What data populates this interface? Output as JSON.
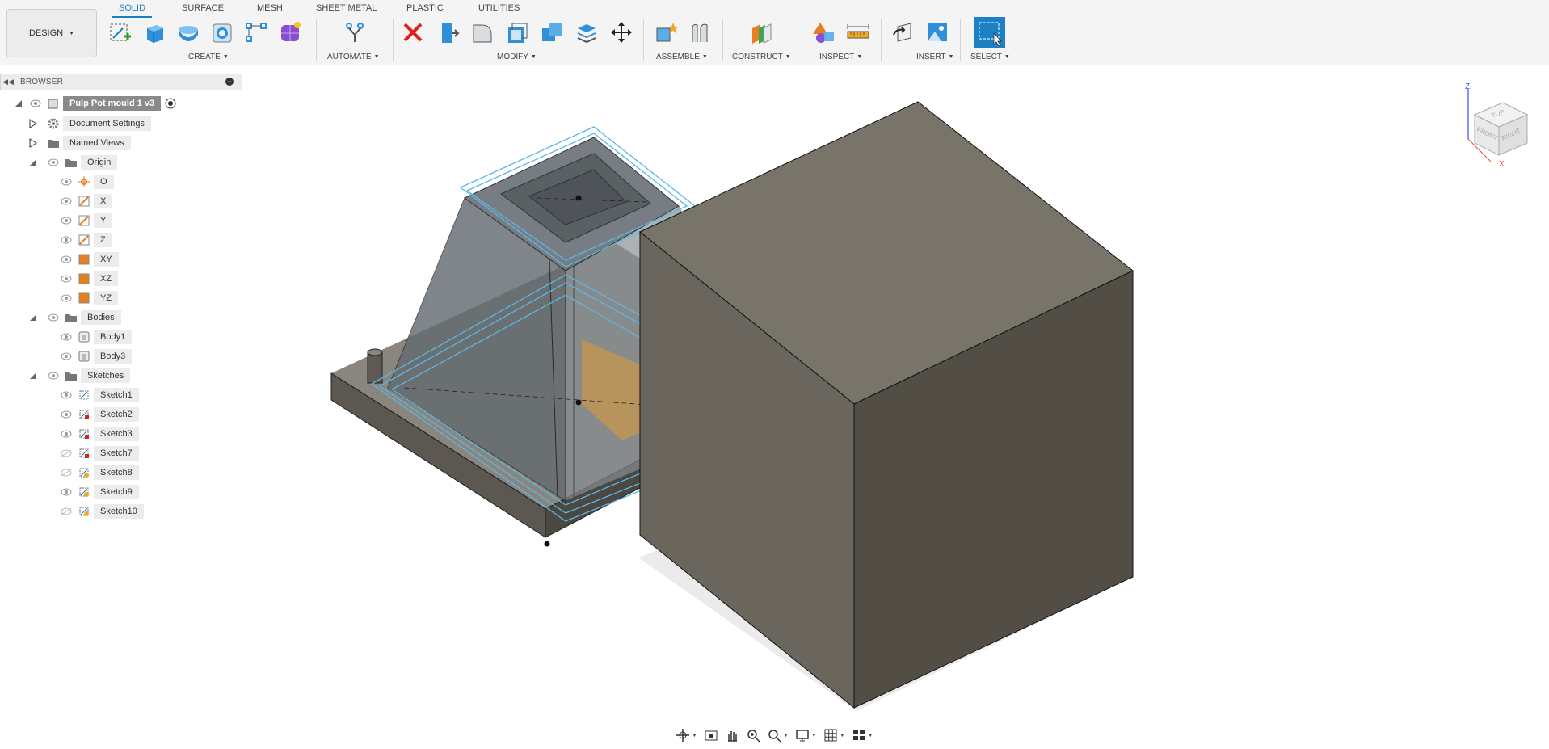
{
  "workspace": {
    "label": "DESIGN"
  },
  "tabs": [
    "SOLID",
    "SURFACE",
    "MESH",
    "SHEET METAL",
    "PLASTIC",
    "UTILITIES"
  ],
  "active_tab": "SOLID",
  "tool_groups": {
    "create": "CREATE",
    "automate": "AUTOMATE",
    "modify": "MODIFY",
    "assemble": "ASSEMBLE",
    "construct": "CONSTRUCT",
    "inspect": "INSPECT",
    "insert": "INSERT",
    "select": "SELECT"
  },
  "browser": {
    "title": "BROWSER",
    "root": "Pulp Pot mould 1 v3",
    "document_settings": "Document Settings",
    "named_views": "Named Views",
    "origin": {
      "label": "Origin",
      "items": [
        "O",
        "X",
        "Y",
        "Z",
        "XY",
        "XZ",
        "YZ"
      ]
    },
    "bodies": {
      "label": "Bodies",
      "items": [
        "Body1",
        "Body3"
      ]
    },
    "sketches": {
      "label": "Sketches",
      "items": [
        {
          "label": "Sketch1",
          "visible": true
        },
        {
          "label": "Sketch2",
          "visible": true
        },
        {
          "label": "Sketch3",
          "visible": true
        },
        {
          "label": "Sketch7",
          "visible": false
        },
        {
          "label": "Sketch8",
          "visible": false
        },
        {
          "label": "Sketch9",
          "visible": true
        },
        {
          "label": "Sketch10",
          "visible": false
        }
      ]
    }
  },
  "viewcube": {
    "top": "TOP",
    "front": "FRONT",
    "right": "RIGHT",
    "axis_x": "X",
    "axis_z": "Z"
  },
  "colors": {
    "accent": "#1b80c4",
    "body_dark": "#514d45",
    "body_mid": "#6b665d",
    "body_light": "#7c776e",
    "sketch_line": "#5ab8e8"
  }
}
